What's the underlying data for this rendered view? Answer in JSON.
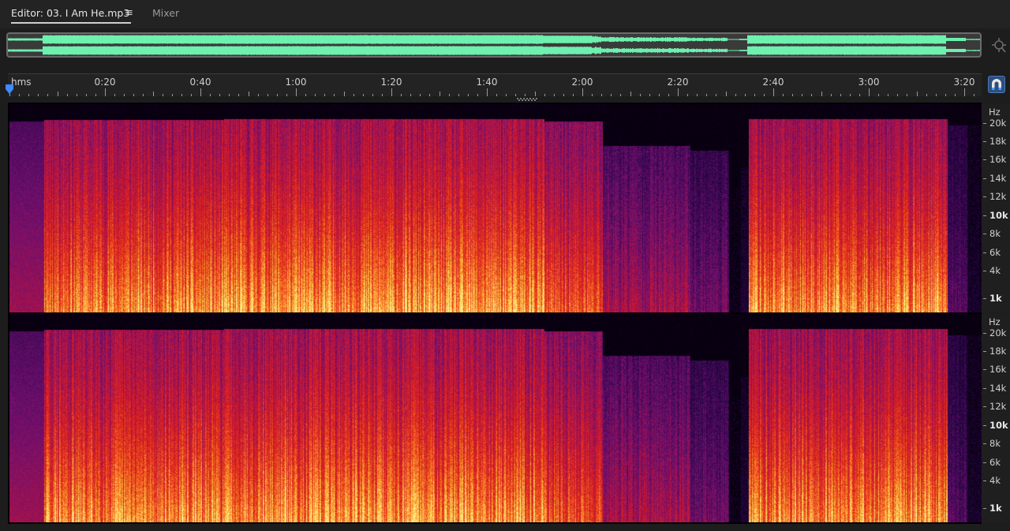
{
  "tabs": {
    "editor_label": "Editor: 03. I Am He.mp3",
    "menu_glyph": "≡",
    "mixer_label": "Mixer"
  },
  "overview": {
    "waveform_color": "#6ef0ae",
    "background_color": "#3a3a3a"
  },
  "icons": {
    "zoom": "zoom-to-selection-icon",
    "playhead": "playhead-icon",
    "snap": "magnet-snap-icon",
    "menu": "hamburger-menu-icon"
  },
  "timeline": {
    "unit_label": "hms",
    "duration_seconds": 205,
    "major_seconds": [
      20,
      40,
      60,
      80,
      100,
      120,
      140,
      160,
      180,
      200
    ],
    "labels": [
      "0:20",
      "0:40",
      "1:00",
      "1:20",
      "1:40",
      "2:00",
      "2:20",
      "2:40",
      "3:00",
      "3:20"
    ]
  },
  "frequency_axis": {
    "unit": "Hz",
    "max_khz": 21.5,
    "labels": [
      {
        "text": "20k",
        "khz": 20,
        "bold": false
      },
      {
        "text": "18k",
        "khz": 18,
        "bold": false
      },
      {
        "text": "16k",
        "khz": 16,
        "bold": false
      },
      {
        "text": "14k",
        "khz": 14,
        "bold": false
      },
      {
        "text": "12k",
        "khz": 12,
        "bold": false
      },
      {
        "text": "10k",
        "khz": 10,
        "bold": true
      },
      {
        "text": "8k",
        "khz": 8,
        "bold": false
      },
      {
        "text": "6k",
        "khz": 6,
        "bold": false
      },
      {
        "text": "4k",
        "khz": 4,
        "bold": false
      },
      {
        "text": "1k",
        "khz": 1,
        "bold": true
      }
    ]
  },
  "channels": [
    "left",
    "right"
  ],
  "colors": {
    "accent_blue": "#3d8bff",
    "spectral_low": "#1a0530",
    "spectral_mid": "#d4221e",
    "spectral_high": "#ffe26a"
  }
}
